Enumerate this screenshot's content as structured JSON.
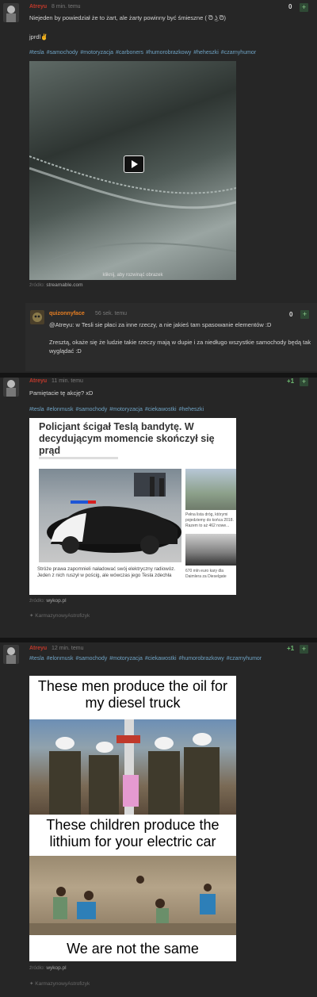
{
  "post1": {
    "username": "Atreyu",
    "time": "8 min. temu",
    "votes": "0",
    "plus": "+",
    "text1": "Niejeden by powiedział że to żart, ale żarty powinny być śmieszne ( ͡ʘ ͜ʖ ͡ʘ)",
    "text2": "jprdl✌",
    "tags": [
      "#tesla",
      "#samochody",
      "#motoryzacja",
      "#carboners",
      "#humorobrazkowy",
      "#heheszki",
      "#czarnyhumor"
    ],
    "media_caption": "kliknij, aby rozwinąć obrazek",
    "source_label": "źródło:",
    "source": "streamable.com"
  },
  "comment1": {
    "username": "quizonnyface",
    "time": "56 sek. temu",
    "votes": "0",
    "plus": "+",
    "text1": "@Atreyu: w Tesli sie płaci za inne rzeczy, a nie jakieś tam spasowanie elementów :D",
    "text2": "Zresztą, okaże się że ludzie takie rzeczy mają w dupie i za niedługo wszystkie samochody będą tak wyglądać :D"
  },
  "post2": {
    "username": "Atreyu",
    "time": "11 min. temu",
    "votes": "+1",
    "plus": "+",
    "text": "Pamiętacie tę akcję? xD",
    "tags": [
      "#tesla",
      "#elonmusk",
      "#samochody",
      "#motoryzacja",
      "#ciekawostki",
      "#heheszki"
    ],
    "article_headline": "Policjant ścigał Teslą bandytę. W decydującym momencie skończył się prąd",
    "article_caption": "Stróże prawa zapomnieli naładować swój elektryczny radiowóz. Jeden z nich ruszył w pościg, ale wówczas jego Tesla zdechła",
    "side_text1": "Pełna lista dróg, którymi pojedziemy do końca 2018. Razem to aż 462 nowe...",
    "side_text2": "670 mln euro kary dla Daimlera za Dieselgate",
    "source_label": "źródło:",
    "source": "wykop.pl",
    "author": "KarmazynowyAstrofizyk"
  },
  "post3": {
    "username": "Atreyu",
    "time": "12 min. temu",
    "votes": "+1",
    "plus": "+",
    "tags": [
      "#tesla",
      "#elonmusk",
      "#samochody",
      "#motoryzacja",
      "#ciekawostki",
      "#humorobrazkowy",
      "#czarnyhumor"
    ],
    "meme_top": "These men produce the oil for my diesel truck",
    "meme_mid": "These children produce the lithium for your electric car",
    "meme_bottom": "We are not the same",
    "source_label": "źródło:",
    "source": "wykop.pl",
    "author": "KarmazynowyAstrofizyk"
  },
  "colors": {
    "username": "#c0392b",
    "tag": "#6fa3c4",
    "plus_bg": "#2f4a35"
  }
}
